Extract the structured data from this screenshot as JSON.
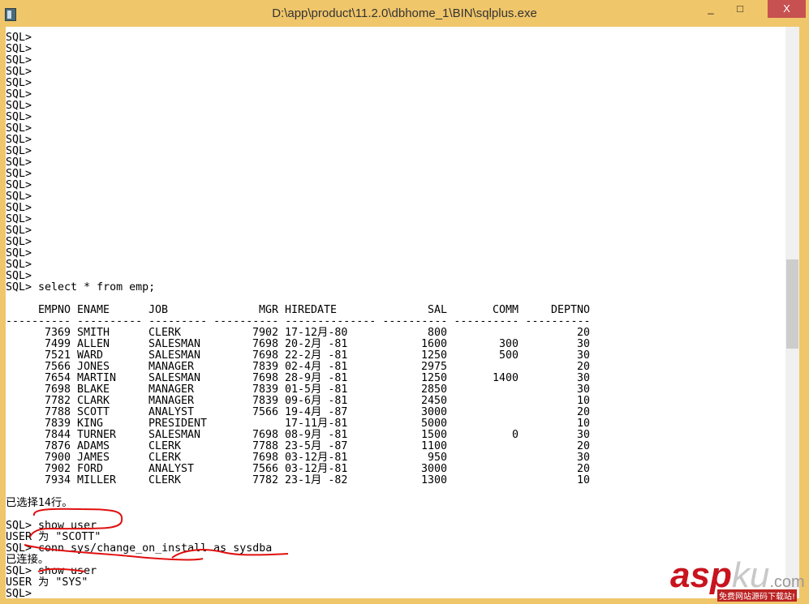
{
  "window": {
    "title": "D:\\app\\product\\11.2.0\\dbhome_1\\BIN\\sqlplus.exe",
    "minimize": "_",
    "maximize": "□",
    "close": "X"
  },
  "console": {
    "empty_prompt": "SQL>",
    "empty_prompt_count": 22,
    "query_line": "SQL> select * from emp;",
    "columns": [
      "EMPNO",
      "ENAME",
      "JOB",
      "MGR",
      "HIREDATE",
      "SAL",
      "COMM",
      "DEPTNO"
    ],
    "rows": [
      [
        "7369",
        "SMITH",
        "CLERK",
        "7902",
        "17-12月-80",
        "800",
        "",
        "20"
      ],
      [
        "7499",
        "ALLEN",
        "SALESMAN",
        "7698",
        "20-2月 -81",
        "1600",
        "300",
        "30"
      ],
      [
        "7521",
        "WARD",
        "SALESMAN",
        "7698",
        "22-2月 -81",
        "1250",
        "500",
        "30"
      ],
      [
        "7566",
        "JONES",
        "MANAGER",
        "7839",
        "02-4月 -81",
        "2975",
        "",
        "20"
      ],
      [
        "7654",
        "MARTIN",
        "SALESMAN",
        "7698",
        "28-9月 -81",
        "1250",
        "1400",
        "30"
      ],
      [
        "7698",
        "BLAKE",
        "MANAGER",
        "7839",
        "01-5月 -81",
        "2850",
        "",
        "30"
      ],
      [
        "7782",
        "CLARK",
        "MANAGER",
        "7839",
        "09-6月 -81",
        "2450",
        "",
        "10"
      ],
      [
        "7788",
        "SCOTT",
        "ANALYST",
        "7566",
        "19-4月 -87",
        "3000",
        "",
        "20"
      ],
      [
        "7839",
        "KING",
        "PRESIDENT",
        "",
        "17-11月-81",
        "5000",
        "",
        "10"
      ],
      [
        "7844",
        "TURNER",
        "SALESMAN",
        "7698",
        "08-9月 -81",
        "1500",
        "0",
        "30"
      ],
      [
        "7876",
        "ADAMS",
        "CLERK",
        "7788",
        "23-5月 -87",
        "1100",
        "",
        "20"
      ],
      [
        "7900",
        "JAMES",
        "CLERK",
        "7698",
        "03-12月-81",
        "950",
        "",
        "30"
      ],
      [
        "7902",
        "FORD",
        "ANALYST",
        "7566",
        "03-12月-81",
        "3000",
        "",
        "20"
      ],
      [
        "7934",
        "MILLER",
        "CLERK",
        "7782",
        "23-1月 -82",
        "1300",
        "",
        "10"
      ]
    ],
    "rows_selected": "已选择14行。",
    "tail": [
      "SQL> show user",
      "USER 为 \"SCOTT\"",
      "SQL> conn sys/change_on_install as sysdba",
      "已连接。",
      "SQL> show user",
      "USER 为 \"SYS\"",
      "SQL>"
    ]
  },
  "watermark": {
    "brand": "asp",
    "brand2": "ku",
    "domain": ".com",
    "slogan": "免费网站源码下载站!"
  }
}
